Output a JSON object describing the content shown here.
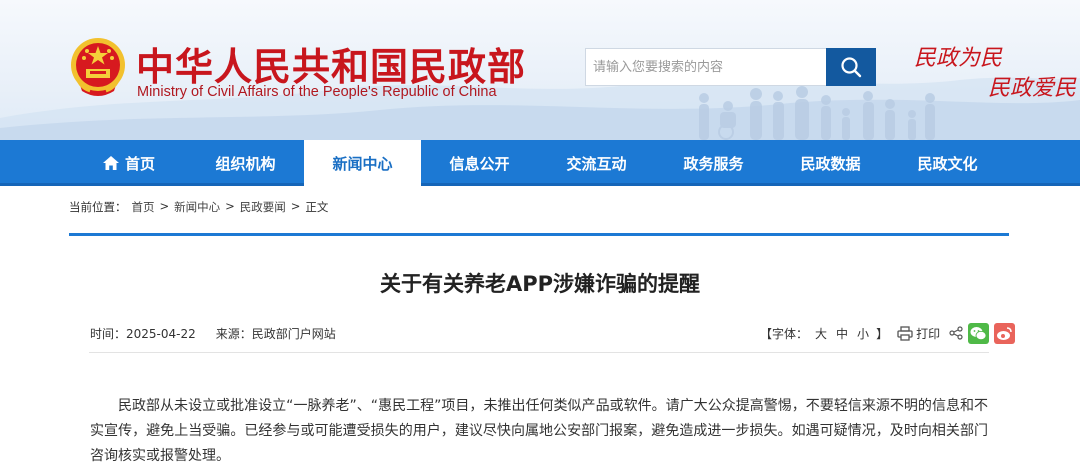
{
  "header": {
    "site_title": "中华人民共和国民政部",
    "site_subtitle": "Ministry of Civil Affairs of the People's Republic of China",
    "search_placeholder": "请输入您要搜索的内容",
    "slogan_line1": "民政为民",
    "slogan_line2": "民政爱民",
    "icons": [
      "national-emblem-icon",
      "search-icon",
      "crowd-silhouette-icon"
    ],
    "colors": {
      "brand_red": "#c8161d",
      "nav_blue": "#1c79d4",
      "search_blue": "#13599f"
    }
  },
  "nav": {
    "items": [
      {
        "label": "首页",
        "icon": "home-icon"
      },
      {
        "label": "组织机构"
      },
      {
        "label": "新闻中心",
        "active": true
      },
      {
        "label": "信息公开"
      },
      {
        "label": "交流互动"
      },
      {
        "label": "政务服务"
      },
      {
        "label": "民政数据"
      },
      {
        "label": "民政文化"
      }
    ]
  },
  "breadcrumb": {
    "prefix": "当前位置：",
    "items": [
      "首页",
      "新闻中心",
      "民政要闻",
      "正文"
    ],
    "separator": ">"
  },
  "article": {
    "title": "关于有关养老APP涉嫌诈骗的提醒",
    "time_label": "时间：2025-04-22",
    "source_label": "来源：民政部门户网站",
    "font_size_label": "【字体：",
    "font_sizes": [
      "大",
      "中",
      "小"
    ],
    "font_size_close": "】",
    "print_label": "打印",
    "share_icons": [
      "share-icon",
      "wechat-icon",
      "weibo-icon"
    ],
    "body": "民政部从未设立或批准设立“一脉养老”、“惠民工程”项目，未推出任何类似产品或软件。请广大公众提高警惕，不要轻信来源不明的信息和不实宣传，避免上当受骗。已经参与或可能遭受损失的用户，建议尽快向属地公安部门报案，避免造成进一步损失。如遇可疑情况，及时向相关部门咨询核实或报警处理。"
  }
}
